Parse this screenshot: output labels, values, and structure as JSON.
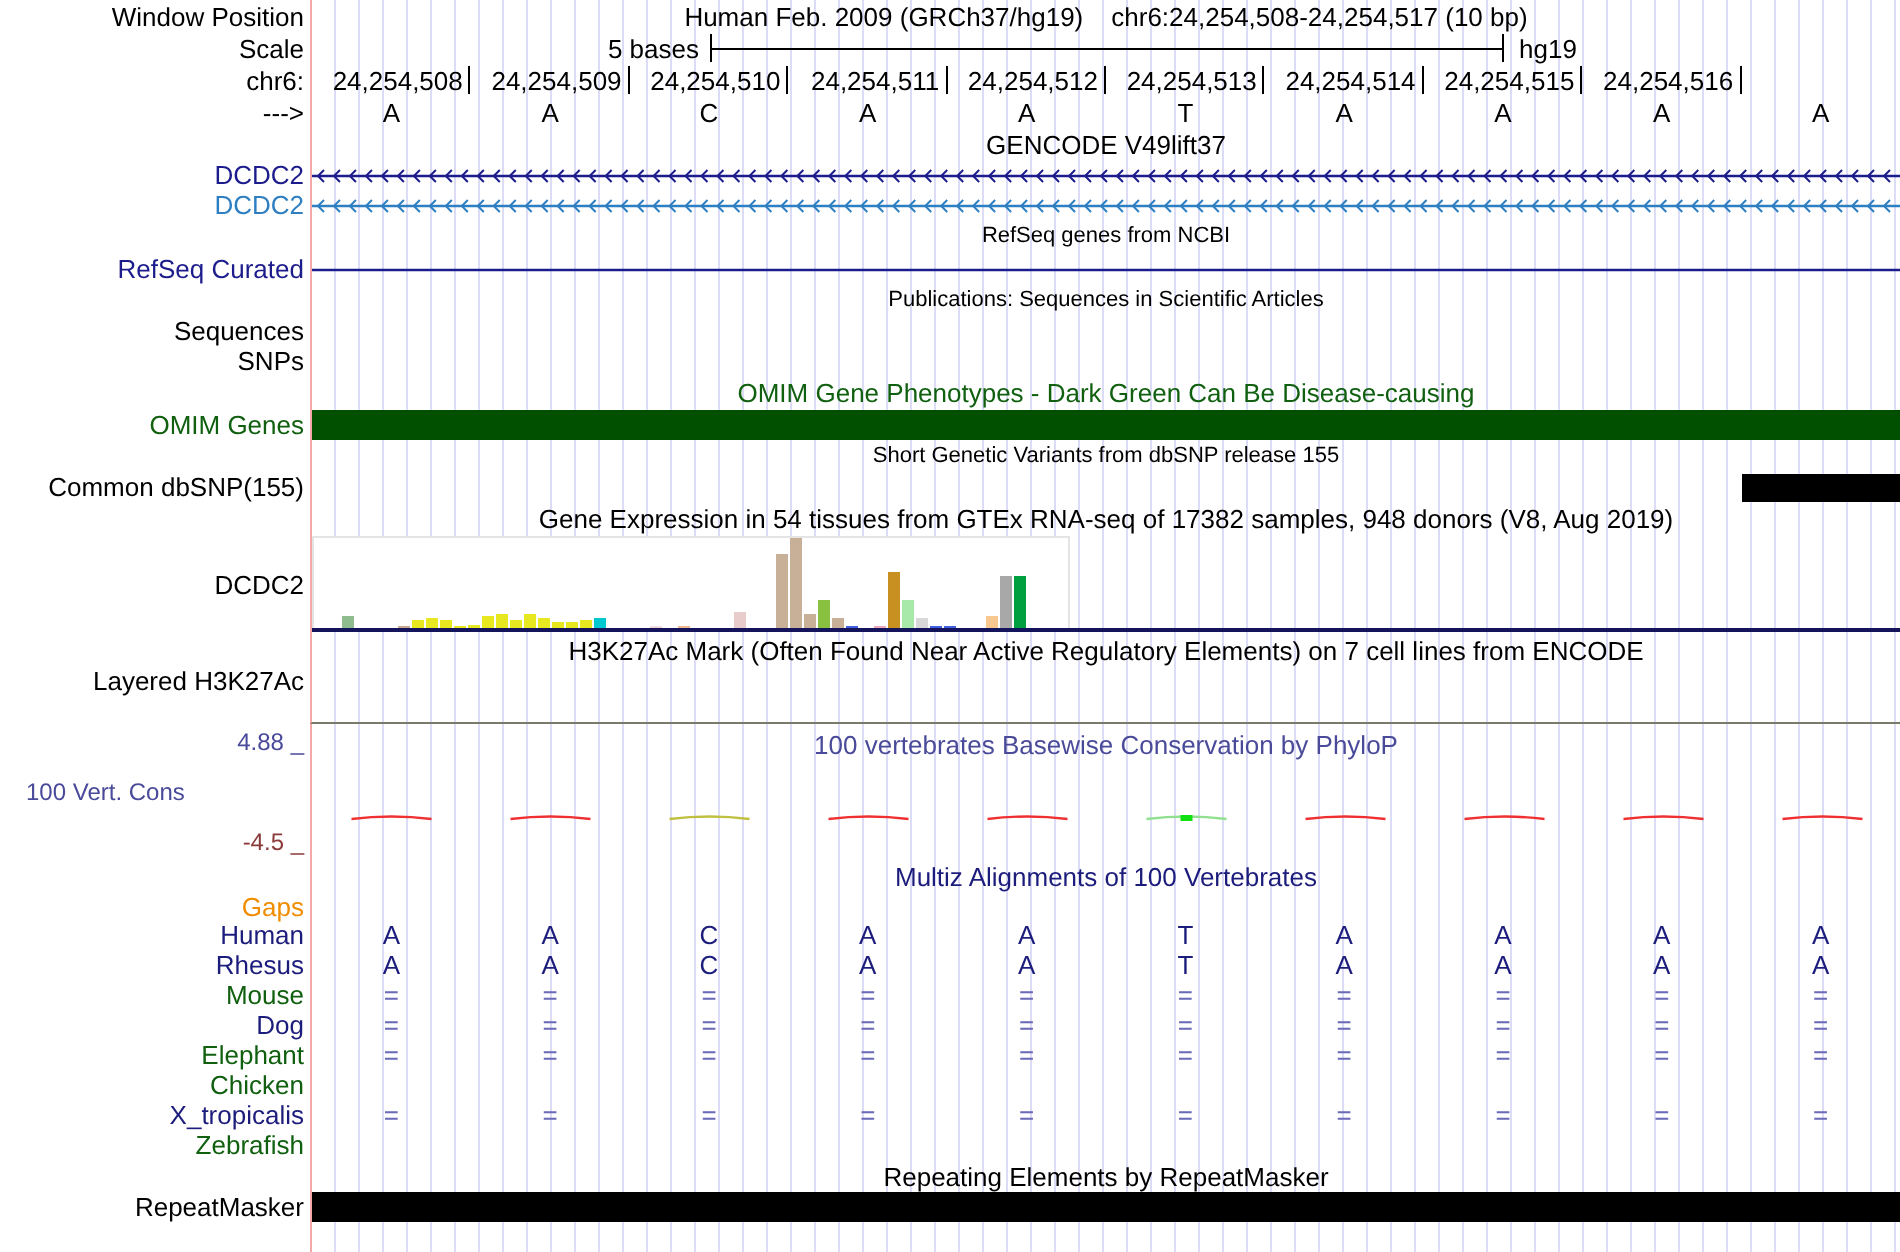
{
  "header": {
    "label": "Window Position",
    "assembly": "Human Feb. 2009 (GRCh37/hg19)",
    "position": "chr6:24,254,508-24,254,517 (10 bp)"
  },
  "scale": {
    "label": "Scale",
    "bar_label": "5 bases",
    "assembly": "hg19"
  },
  "ruler": {
    "label": "chr6:",
    "positions": [
      "24,254,508",
      "24,254,509",
      "24,254,510",
      "24,254,511",
      "24,254,512",
      "24,254,513",
      "24,254,514",
      "24,254,515",
      "24,254,516"
    ]
  },
  "bases": {
    "label": "--->",
    "letters": [
      "A",
      "A",
      "C",
      "A",
      "A",
      "T",
      "A",
      "A",
      "A",
      "A"
    ]
  },
  "tracks": [
    {
      "kind": "gencode",
      "title": "GENCODE V49lift37",
      "genes": [
        {
          "name": "DCDC2",
          "color": "#1c1c8c",
          "arrows": true
        },
        {
          "name": "DCDC2",
          "color": "#2e7fc2",
          "arrows": true
        }
      ]
    },
    {
      "kind": "refseq",
      "title": "RefSeq genes from NCBI",
      "genes": [
        {
          "name": "RefSeq Curated",
          "color": "#1c1c8c",
          "arrows": false
        }
      ]
    },
    {
      "kind": "publications",
      "title": "Publications: Sequences in Scientific Articles",
      "rows": [
        "Sequences",
        "SNPs"
      ]
    },
    {
      "kind": "omim",
      "title": "OMIM Gene Phenotypes - Dark Green Can Be Disease-causing",
      "label": "OMIM Genes"
    },
    {
      "kind": "dbsnp",
      "title": "Short Genetic Variants from dbSNP release 155",
      "label": "Common dbSNP(155)"
    },
    {
      "kind": "gtex",
      "title": "Gene Expression in 54 tissues from GTEx RNA-seq of 17382 samples, 948 donors (V8, Aug 2019)",
      "label": "DCDC2"
    },
    {
      "kind": "h3k27ac",
      "title": "H3K27Ac Mark (Often Found Near Active Regulatory Elements) on 7 cell lines from ENCODE",
      "label": "Layered H3K27Ac"
    },
    {
      "kind": "phylop",
      "title": "100 vertebrates Basewise Conservation by PhyloP",
      "label": "100 Vert. Cons",
      "max": "4.88 _",
      "min": "-4.5 _"
    },
    {
      "kind": "multiz",
      "title": "Multiz Alignments of 100 Vertebrates",
      "gaps_label": "Gaps",
      "species": [
        {
          "name": "Human",
          "color": "#1c1c7c",
          "letters": [
            "A",
            "A",
            "C",
            "A",
            "A",
            "T",
            "A",
            "A",
            "A",
            "A"
          ]
        },
        {
          "name": "Rhesus",
          "color": "#1c1c7c",
          "letters": [
            "A",
            "A",
            "C",
            "A",
            "A",
            "T",
            "A",
            "A",
            "A",
            "A"
          ]
        },
        {
          "name": "Mouse",
          "color": "#106010",
          "letters": [
            "=",
            "=",
            "=",
            "=",
            "=",
            "=",
            "=",
            "=",
            "=",
            "="
          ]
        },
        {
          "name": "Dog",
          "color": "#1c1c7c",
          "letters": [
            "=",
            "=",
            "=",
            "=",
            "=",
            "=",
            "=",
            "=",
            "=",
            "="
          ]
        },
        {
          "name": "Elephant",
          "color": "#106010",
          "letters": [
            "=",
            "=",
            "=",
            "=",
            "=",
            "=",
            "=",
            "=",
            "=",
            "="
          ]
        },
        {
          "name": "Chicken",
          "color": "#106010"
        },
        {
          "name": "X_tropicalis",
          "color": "#1c1c7c",
          "letters": [
            "=",
            "=",
            "=",
            "=",
            "=",
            "=",
            "=",
            "=",
            "=",
            "="
          ]
        },
        {
          "name": "Zebrafish",
          "color": "#106010"
        }
      ]
    },
    {
      "kind": "repeatmasker",
      "title": "Repeating Elements by RepeatMasker",
      "label": "RepeatMasker"
    }
  ]
}
